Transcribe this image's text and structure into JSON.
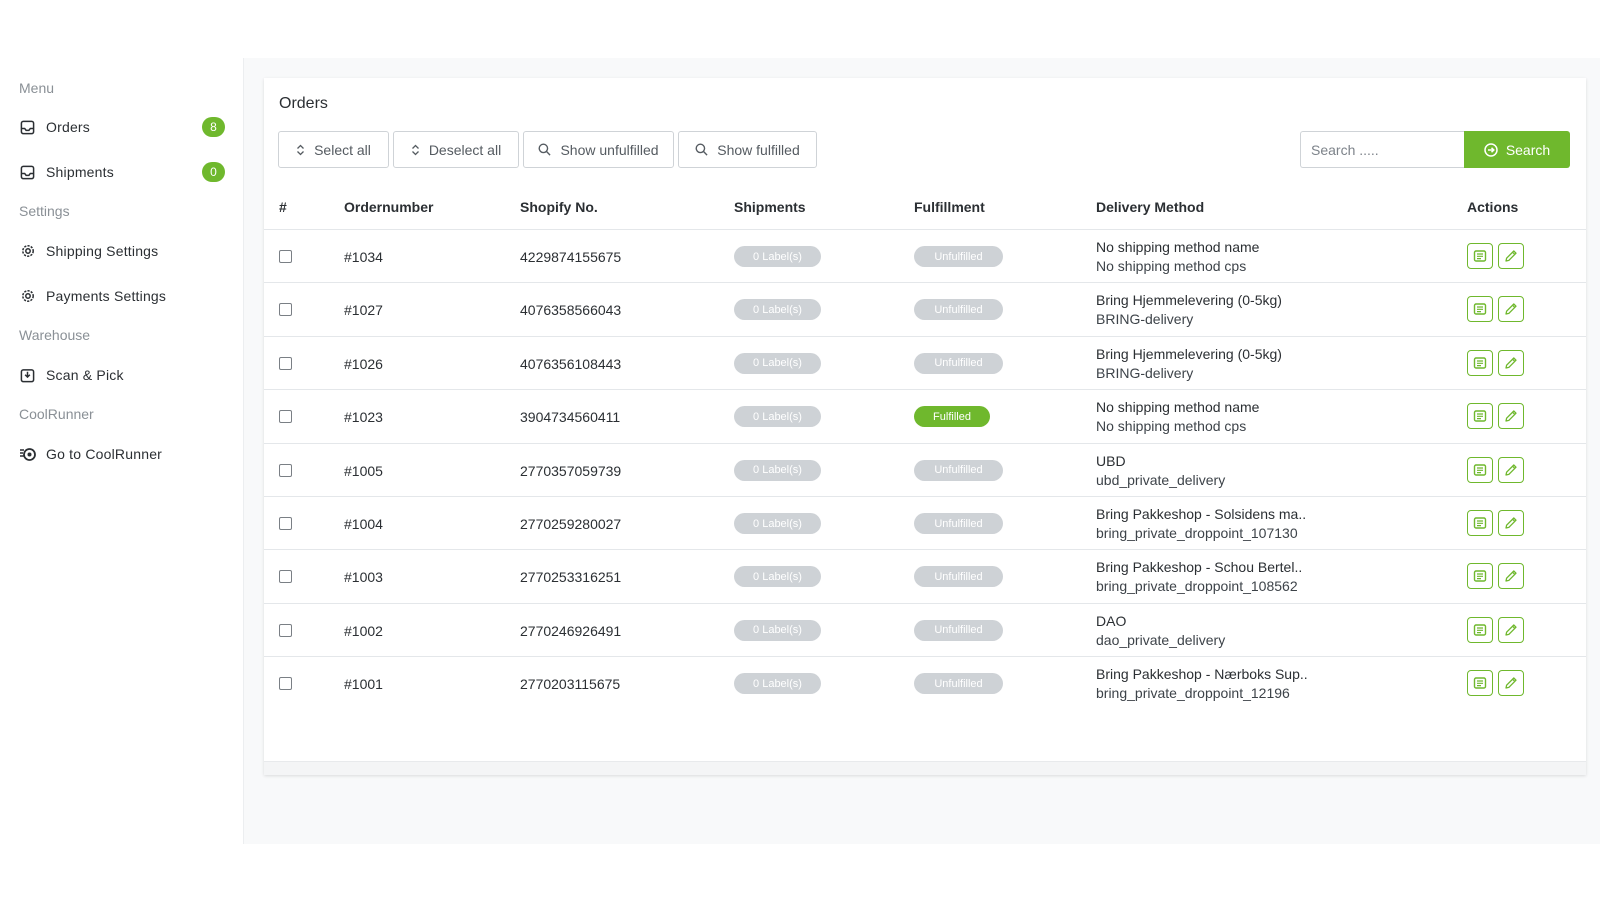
{
  "sidebar": {
    "sections": [
      {
        "heading": "Menu"
      },
      {
        "heading": "Settings"
      },
      {
        "heading": "Warehouse"
      },
      {
        "heading": "CoolRunner"
      }
    ],
    "items": {
      "orders": {
        "label": "Orders",
        "badge": "8",
        "icon": "inbox-icon"
      },
      "shipments": {
        "label": "Shipments",
        "badge": "0",
        "icon": "inbox-icon"
      },
      "shipping_settings": {
        "label": "Shipping Settings",
        "icon": "gear-icon"
      },
      "payments_settings": {
        "label": "Payments Settings",
        "icon": "gear-icon"
      },
      "scan_pick": {
        "label": "Scan & Pick",
        "icon": "download-box-icon"
      },
      "coolrunner": {
        "label": "Go to CoolRunner",
        "icon": "coolrunner-logo-icon"
      }
    }
  },
  "page": {
    "title": "Orders"
  },
  "toolbar": {
    "select_all": "Select all",
    "deselect_all": "Deselect all",
    "show_unfulfilled": "Show unfulfilled",
    "show_fulfilled": "Show fulfilled",
    "search_placeholder": "Search .....",
    "search_button": "Search"
  },
  "table": {
    "headers": [
      "#",
      "Ordernumber",
      "Shopify No.",
      "Shipments",
      "Fulfillment",
      "Delivery Method",
      "Actions"
    ],
    "rows": [
      {
        "order": "#1034",
        "shopify": "4229874155675",
        "labels": "0 Label(s)",
        "fulfillment": "Unfulfilled",
        "method": "No shipping method name",
        "method_code": "No shipping method cps"
      },
      {
        "order": "#1027",
        "shopify": "4076358566043",
        "labels": "0 Label(s)",
        "fulfillment": "Unfulfilled",
        "method": "Bring Hjemmelevering (0-5kg)",
        "method_code": "BRING-delivery"
      },
      {
        "order": "#1026",
        "shopify": "4076356108443",
        "labels": "0 Label(s)",
        "fulfillment": "Unfulfilled",
        "method": "Bring Hjemmelevering (0-5kg)",
        "method_code": "BRING-delivery"
      },
      {
        "order": "#1023",
        "shopify": "3904734560411",
        "labels": "0 Label(s)",
        "fulfillment": "Fulfilled",
        "method": "No shipping method name",
        "method_code": "No shipping method cps"
      },
      {
        "order": "#1005",
        "shopify": "2770357059739",
        "labels": "0 Label(s)",
        "fulfillment": "Unfulfilled",
        "method": "UBD",
        "method_code": "ubd_private_delivery"
      },
      {
        "order": "#1004",
        "shopify": "2770259280027",
        "labels": "0 Label(s)",
        "fulfillment": "Unfulfilled",
        "method": "Bring Pakkeshop - Solsidens ma..",
        "method_code": "bring_private_droppoint_107130"
      },
      {
        "order": "#1003",
        "shopify": "2770253316251",
        "labels": "0 Label(s)",
        "fulfillment": "Unfulfilled",
        "method": "Bring Pakkeshop - Schou Bertel..",
        "method_code": "bring_private_droppoint_108562"
      },
      {
        "order": "#1002",
        "shopify": "2770246926491",
        "labels": "0 Label(s)",
        "fulfillment": "Unfulfilled",
        "method": "DAO",
        "method_code": "dao_private_delivery"
      },
      {
        "order": "#1001",
        "shopify": "2770203115675",
        "labels": "0 Label(s)",
        "fulfillment": "Unfulfilled",
        "method": "Bring Pakkeshop - Nærboks Sup..",
        "method_code": "bring_private_droppoint_12196"
      }
    ]
  },
  "colors": {
    "accent": "#6fb82d",
    "muted_pill": "#ced2d6",
    "background": "#f8f9fa"
  }
}
